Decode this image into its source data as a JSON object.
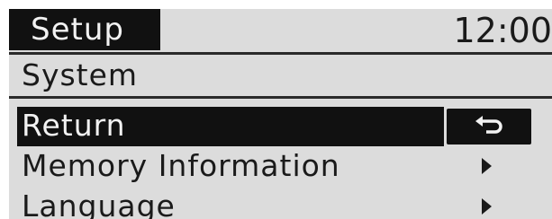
{
  "header": {
    "title": "Setup",
    "clock": "12:00"
  },
  "subtitle": "System",
  "menu": {
    "items": [
      {
        "label": "Return",
        "selected": true,
        "icon": "return-arrow-icon"
      },
      {
        "label": "Memory Information",
        "selected": false,
        "icon": "chevron-right-icon"
      },
      {
        "label": "Language",
        "selected": false,
        "icon": "chevron-right-icon"
      }
    ]
  }
}
